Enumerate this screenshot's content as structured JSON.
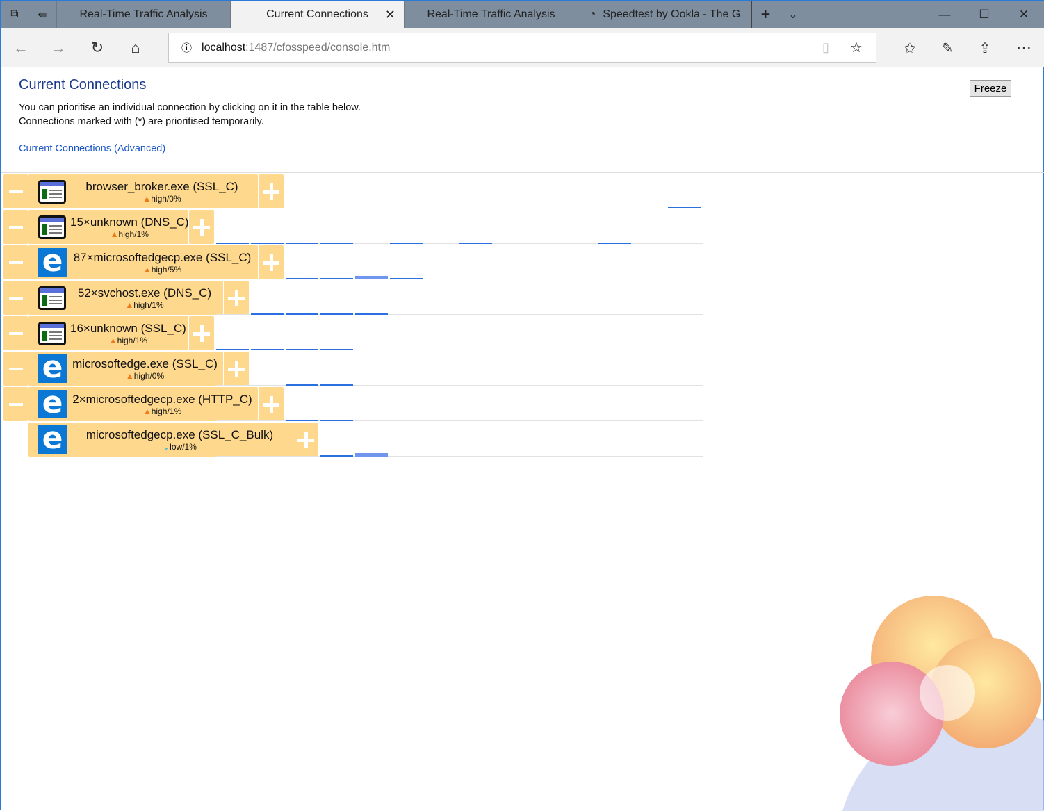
{
  "browser": {
    "tabs": [
      {
        "label": "Real-Time Traffic Analysis"
      },
      {
        "label": "Current Connections",
        "active": true
      },
      {
        "label": "Real-Time Traffic Analysis"
      },
      {
        "label": "Speedtest by Ookla - The G"
      }
    ],
    "address_host": "localhost",
    "address_path": ":1487/cfosspeed/console.htm"
  },
  "page": {
    "title": "Current Connections",
    "line1": "You can prioritise an individual connection by clicking on it in the table below.",
    "line2": "Connections marked with (*) are prioritised temporarily.",
    "advanced_link": "Current Connections (Advanced)",
    "freeze_label": "Freeze"
  },
  "connections": [
    {
      "name": "browser_broker.exe (SSL_C)",
      "priority": "high",
      "percent": "0%",
      "icon": "app-window-icon",
      "activity": {
        "13": 1
      }
    },
    {
      "name": "15×unknown (DNS_C)",
      "priority": "high",
      "percent": "1%",
      "icon": "app-window-icon",
      "activity": {
        "0": 1,
        "1": 1,
        "2": 1,
        "3": 1,
        "5": 1,
        "7": 1,
        "11": 1
      }
    },
    {
      "name": "87×microsoftedgecp.exe (SSL_C)",
      "priority": "high",
      "percent": "5%",
      "icon": "edge-icon",
      "activity": {
        "2": 1,
        "3": 1,
        "4": 3,
        "5": 1
      }
    },
    {
      "name": "52×svchost.exe (DNS_C)",
      "priority": "high",
      "percent": "1%",
      "icon": "app-window-icon",
      "activity": {
        "1": 1,
        "2": 1,
        "3": 1,
        "4": 1
      }
    },
    {
      "name": "16×unknown (SSL_C)",
      "priority": "high",
      "percent": "1%",
      "icon": "app-window-icon",
      "activity": {
        "0": 1,
        "1": 1,
        "2": 1,
        "3": 1
      }
    },
    {
      "name": "microsoftedge.exe (SSL_C)",
      "priority": "high",
      "percent": "0%",
      "icon": "edge-icon",
      "activity": {
        "2": 1,
        "3": 1
      }
    },
    {
      "name": "2×microsoftedgecp.exe (HTTP_C)",
      "priority": "high",
      "percent": "1%",
      "icon": "edge-icon",
      "activity": {
        "2": 1,
        "3": 1
      }
    },
    {
      "name": "microsoftedgecp.exe (SSL_C_Bulk)",
      "priority": "low",
      "percent": "1%",
      "icon": "edge-icon",
      "no_minus": true,
      "activity": {
        "3": 1,
        "4": 3
      }
    }
  ]
}
